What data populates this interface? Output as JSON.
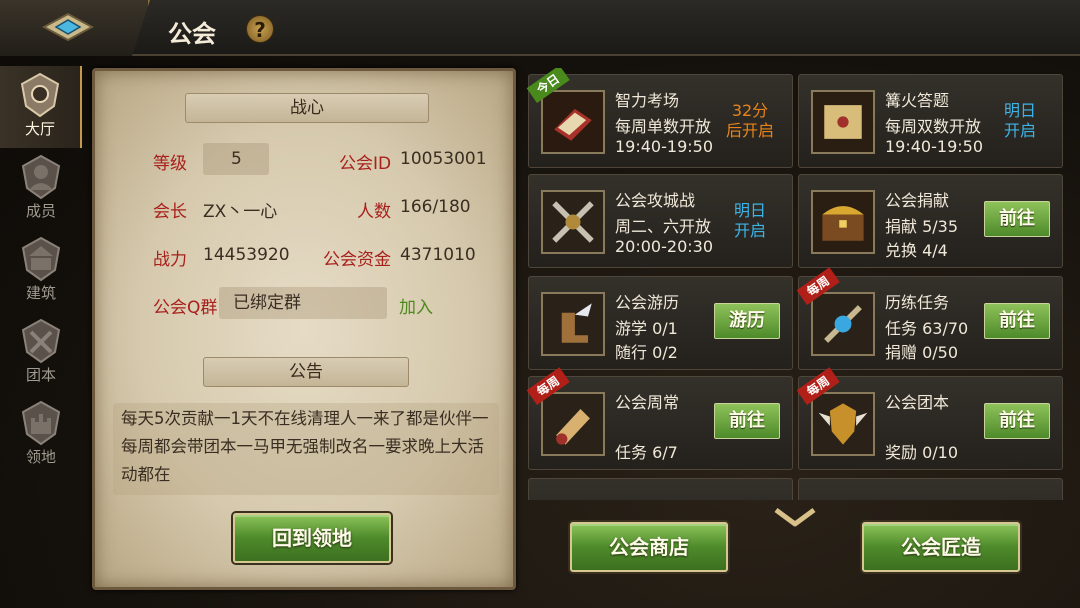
{
  "header": {
    "title": "公会",
    "help_icon": "?"
  },
  "sidenav": [
    {
      "label": "大厅",
      "icon": "hall-icon",
      "active": true
    },
    {
      "label": "成员",
      "icon": "members-icon",
      "active": false
    },
    {
      "label": "建筑",
      "icon": "building-icon",
      "active": false
    },
    {
      "label": "团本",
      "icon": "raid-icon",
      "active": false
    },
    {
      "label": "领地",
      "icon": "territory-icon",
      "active": false
    }
  ],
  "guild": {
    "name": "战心",
    "level_label": "等级",
    "level": "5",
    "id_label": "公会ID",
    "id": "10053001",
    "leader_label": "会长",
    "leader": "ZX丶一心",
    "members_label": "人数",
    "members": "166/180",
    "power_label": "战力",
    "power": "14453920",
    "funds_label": "公会资金",
    "funds": "4371010",
    "qq_label": "公会Q群",
    "qq_status": "已绑定群",
    "join_label": "加入",
    "notice_header": "公告",
    "notice_text": "每天5次贡献一1天不在线清理人一来了都是伙伴一每周都会带团本一马甲无强制改名一要求晚上大活动都在",
    "return_button": "回到领地"
  },
  "activities": [
    {
      "title": "智力考场",
      "line2": "每周单数开放",
      "line3": "19:40-19:50",
      "ribbon": "今日",
      "ribbon_color": "#4a8a1c",
      "status": "32分\n后开启",
      "status_color": "orange"
    },
    {
      "title": "篝火答题",
      "line2": "每周双数开放",
      "line3": "19:40-19:50",
      "ribbon": "",
      "status": "明日\n开启",
      "status_color": "blue"
    },
    {
      "title": "公会攻城战",
      "line2": "周二、六开放",
      "line3": "20:00-20:30",
      "ribbon": "",
      "status": "明日\n开启",
      "status_color": "blue"
    },
    {
      "title": "公会捐献",
      "line2": "捐献 5/35",
      "line3": "兑换 4/4",
      "ribbon": "",
      "button": "前往"
    },
    {
      "title": "公会游历",
      "line2": "游学 0/1",
      "line3": "随行 0/2",
      "ribbon": "",
      "button": "游历"
    },
    {
      "title": "历练任务",
      "line2": "任务 63/70",
      "line3": "捐赠 0/50",
      "ribbon": "每周",
      "ribbon_color": "#b02018",
      "button": "前往"
    },
    {
      "title": "公会周常",
      "line2": "",
      "line3": "任务 6/7",
      "ribbon": "每周",
      "ribbon_color": "#b02018",
      "button": "前往"
    },
    {
      "title": "公会团本",
      "line2": "",
      "line3": "奖励 0/10",
      "ribbon": "每周",
      "ribbon_color": "#b02018",
      "button": "前往"
    }
  ],
  "bottom": {
    "shop_button": "公会商店",
    "craft_button": "公会匠造"
  }
}
